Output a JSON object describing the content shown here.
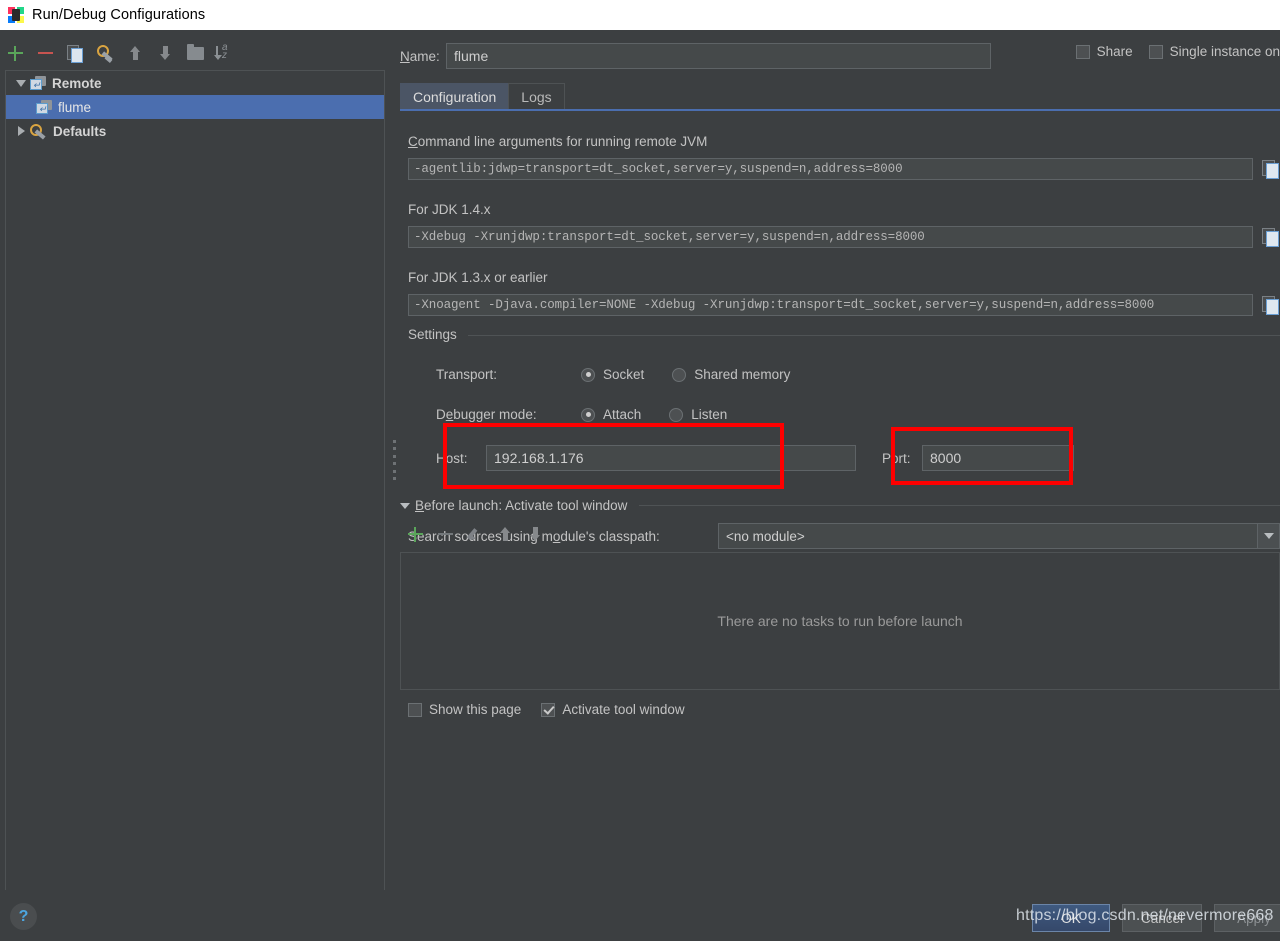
{
  "window": {
    "title": "Run/Debug Configurations",
    "icon": "intellij-idea-icon"
  },
  "sidebar": {
    "toolbar": [
      {
        "name": "add-button",
        "icon": "plus-icon",
        "label": "Add New Configuration"
      },
      {
        "name": "remove-button",
        "icon": "minus-icon",
        "label": "Remove Configuration"
      },
      {
        "name": "copy-button",
        "icon": "copy-icon",
        "label": "Copy Configuration"
      },
      {
        "name": "edit-defaults-button",
        "icon": "wrench-icon",
        "label": "Edit defaults"
      },
      {
        "name": "move-up-button",
        "icon": "arrow-up-icon",
        "label": "Move Up"
      },
      {
        "name": "move-down-button",
        "icon": "arrow-down-icon",
        "label": "Move Down"
      },
      {
        "name": "folder-button",
        "icon": "folder-icon",
        "label": "Create New Folder"
      },
      {
        "name": "sort-button",
        "icon": "sort-alphabetical-icon",
        "label": "Sort Configurations"
      }
    ],
    "tree": [
      {
        "label": "Remote",
        "icon": "remote-config-icon",
        "expanded": true,
        "level": 0,
        "selected": false,
        "bold": true
      },
      {
        "label": "flume",
        "icon": "remote-config-icon",
        "expanded": null,
        "level": 1,
        "selected": true,
        "bold": false
      },
      {
        "label": "Defaults",
        "icon": "wrench-icon",
        "expanded": false,
        "level": 0,
        "selected": false,
        "bold": true
      }
    ]
  },
  "header": {
    "name_label": "Name:",
    "name_value": "flume",
    "share": {
      "label": "Share",
      "checked": false
    },
    "single_instance": {
      "label": "Single instance on",
      "checked": false
    }
  },
  "tabs": [
    {
      "label": "Configuration",
      "active": true
    },
    {
      "label": "Logs",
      "active": false
    }
  ],
  "configuration": {
    "cmdline_label": "Command line arguments for running remote JVM",
    "cmdline_value": "-agentlib:jdwp=transport=dt_socket,server=y,suspend=n,address=8000",
    "jdk14_label": "For JDK 1.4.x",
    "jdk14_value": "-Xdebug -Xrunjdwp:transport=dt_socket,server=y,suspend=n,address=8000",
    "jdk13_label": "For JDK 1.3.x or earlier",
    "jdk13_value": "-Xnoagent -Djava.compiler=NONE -Xdebug -Xrunjdwp:transport=dt_socket,server=y,suspend=n,address=8000",
    "copy_icon": "copy-icon",
    "settings": {
      "group_title": "Settings",
      "transport_label": "Transport:",
      "transport_options": [
        {
          "label": "Socket",
          "selected": true
        },
        {
          "label": "Shared memory",
          "selected": false
        }
      ],
      "debugger_mode_label": "Debugger mode:",
      "debugger_mode_options": [
        {
          "label": "Attach",
          "selected": true
        },
        {
          "label": "Listen",
          "selected": false
        }
      ],
      "host_label": "Host:",
      "host_value": "192.168.1.176",
      "port_label": "Port:",
      "port_value": "8000"
    },
    "classpath_label": "Search sources using module's classpath:",
    "classpath_value": "<no module>"
  },
  "before_launch": {
    "title": "Before launch: Activate tool window",
    "toolbar": [
      {
        "name": "add-task-button",
        "icon": "plus-icon"
      },
      {
        "name": "remove-task-button",
        "icon": "minus-icon"
      },
      {
        "name": "edit-task-button",
        "icon": "pencil-icon"
      },
      {
        "name": "task-move-up-button",
        "icon": "arrow-up-icon"
      },
      {
        "name": "task-move-down-button",
        "icon": "arrow-down-icon"
      }
    ],
    "empty_text": "There are no tasks to run before launch",
    "show_this_page": {
      "label": "Show this page",
      "checked": false
    },
    "activate_tool_window": {
      "label": "Activate tool window",
      "checked": true
    }
  },
  "footer": {
    "help_icon": "question-mark-icon",
    "ok_label": "OK",
    "cancel_label": "Cancel",
    "apply_label": "Apply",
    "watermark": "https://blog.csdn.net/nevermore668"
  },
  "annotations": [
    {
      "name": "host-highlight-box",
      "color": "#fe0000"
    },
    {
      "name": "port-highlight-box",
      "color": "#fe0000"
    }
  ]
}
